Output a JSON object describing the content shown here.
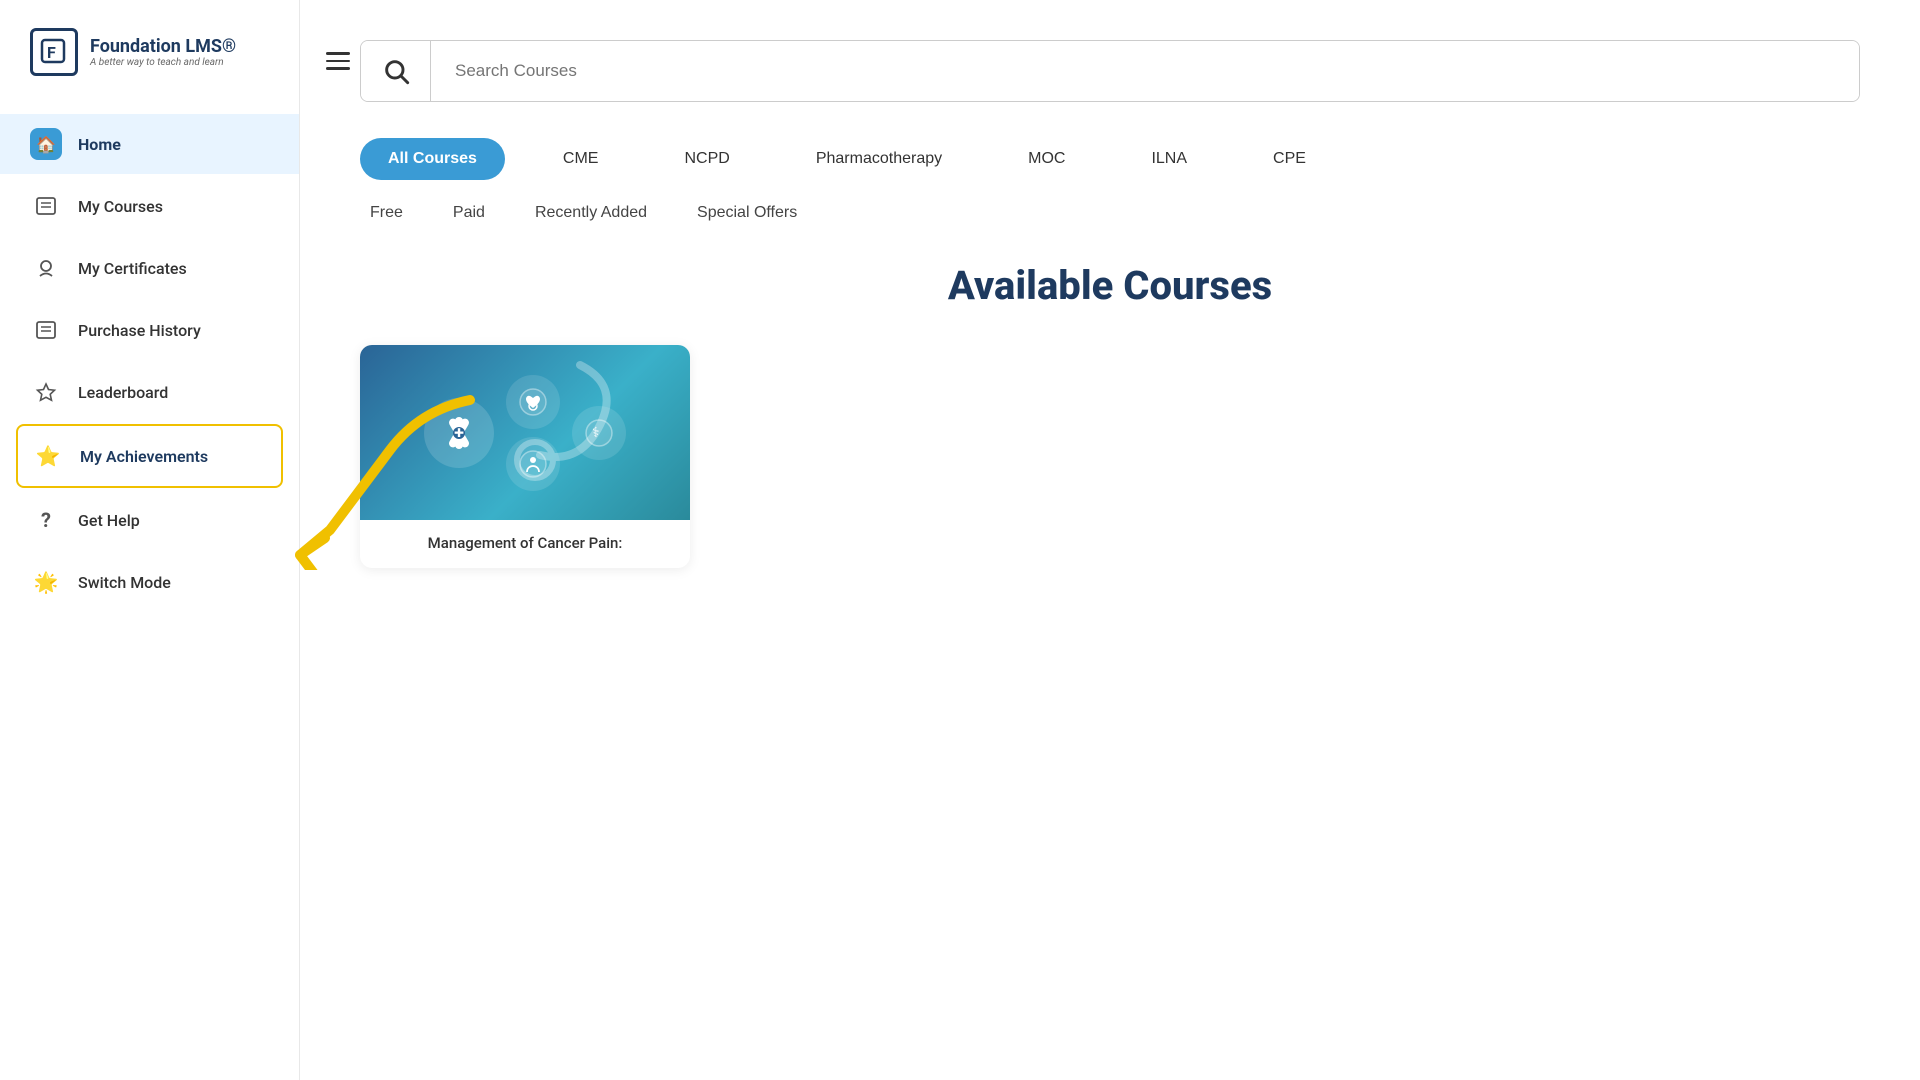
{
  "app": {
    "name": "Foundation LMS®",
    "tagline": "A better way to teach and learn"
  },
  "sidebar": {
    "items": [
      {
        "id": "home",
        "label": "Home",
        "icon": "🏠",
        "active": true,
        "highlighted": false
      },
      {
        "id": "my-courses",
        "label": "My Courses",
        "icon": "📋",
        "active": false,
        "highlighted": false
      },
      {
        "id": "my-certificates",
        "label": "My Certificates",
        "icon": "👤",
        "active": false,
        "highlighted": false
      },
      {
        "id": "purchase-history",
        "label": "Purchase History",
        "icon": "📋",
        "active": false,
        "highlighted": false
      },
      {
        "id": "leaderboard",
        "label": "Leaderboard",
        "icon": "🏆",
        "active": false,
        "highlighted": false
      },
      {
        "id": "my-achievements",
        "label": "My Achievements",
        "icon": "⭐",
        "active": false,
        "highlighted": true
      },
      {
        "id": "get-help",
        "label": "Get Help",
        "icon": "?",
        "active": false,
        "highlighted": false
      },
      {
        "id": "switch-mode",
        "label": "Switch Mode",
        "icon": "☀",
        "active": false,
        "highlighted": false
      }
    ]
  },
  "search": {
    "placeholder": "Search Courses"
  },
  "filter_tabs": {
    "primary": [
      {
        "id": "all-courses",
        "label": "All Courses",
        "active": true
      },
      {
        "id": "cme",
        "label": "CME",
        "active": false
      },
      {
        "id": "ncpd",
        "label": "NCPD",
        "active": false
      },
      {
        "id": "pharmacotherapy",
        "label": "Pharmacotherapy",
        "active": false
      },
      {
        "id": "moc",
        "label": "MOC",
        "active": false
      },
      {
        "id": "ilna",
        "label": "ILNA",
        "active": false
      },
      {
        "id": "cpe",
        "label": "CPE",
        "active": false
      }
    ],
    "secondary": [
      {
        "id": "free",
        "label": "Free"
      },
      {
        "id": "paid",
        "label": "Paid"
      },
      {
        "id": "recently-added",
        "label": "Recently Added"
      },
      {
        "id": "special-offers",
        "label": "Special Offers"
      }
    ]
  },
  "main": {
    "section_title": "Available Courses"
  },
  "courses": [
    {
      "id": "course-1",
      "title": "Management of Cancer Pain:",
      "image_alt": "Medical course thumbnail"
    }
  ]
}
